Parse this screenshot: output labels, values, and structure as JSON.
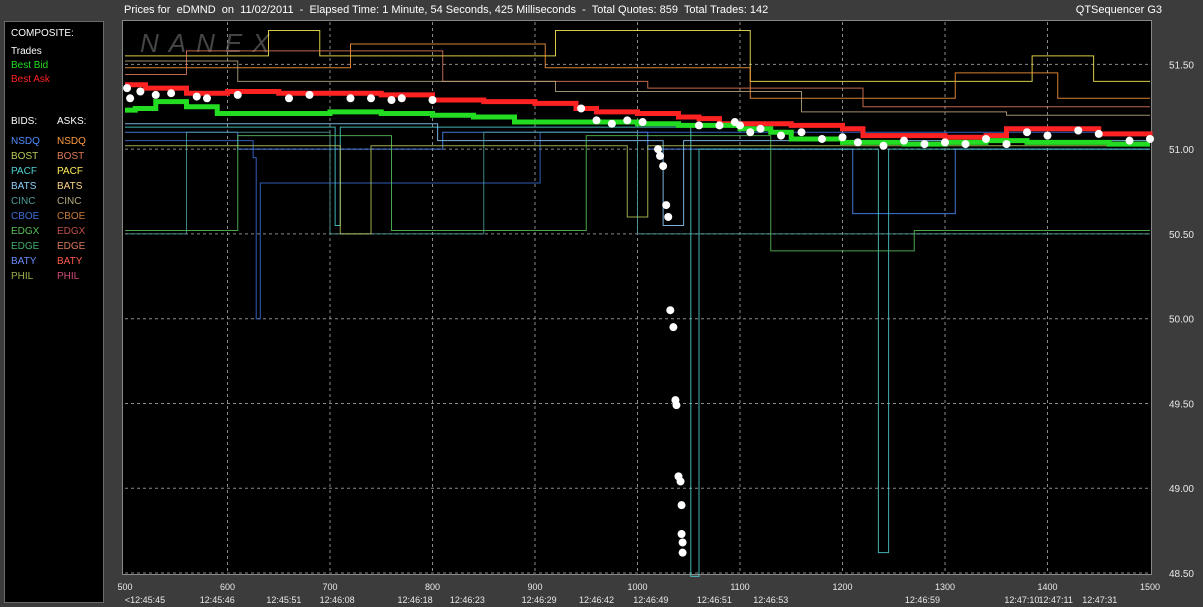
{
  "header": {
    "title": "Prices for  eDMND  on  11/02/2011  -  Elapsed Time: 1 Minute, 54 Seconds, 425 Milliseconds  -  Total Quotes: 859  Total Trades: 142",
    "app": "QTSequencer G3"
  },
  "watermark": "NANEX",
  "legend": {
    "composite_title": "COMPOSITE:",
    "composite": [
      {
        "label": "Trades",
        "color": "#ffffff"
      },
      {
        "label": "Best Bid",
        "color": "#22dd22"
      },
      {
        "label": "Best Ask",
        "color": "#ff2222"
      }
    ],
    "bids_title": "BIDS:",
    "asks_title": "ASKS:",
    "exchanges": [
      {
        "bid": "NSDQ",
        "ask": "NSDQ",
        "bid_color": "#4f8cff",
        "ask_color": "#ff9a3c"
      },
      {
        "bid": "BOST",
        "ask": "BOST",
        "bid_color": "#b7c95a",
        "ask_color": "#e07a5a"
      },
      {
        "bid": "PACF",
        "ask": "PACF",
        "bid_color": "#4fd2d2",
        "ask_color": "#ffee55"
      },
      {
        "bid": "BATS",
        "ask": "BATS",
        "bid_color": "#8fd0ff",
        "ask_color": "#ffd68a"
      },
      {
        "bid": "CINC",
        "ask": "CINC",
        "bid_color": "#4f9a9a",
        "ask_color": "#b8a980"
      },
      {
        "bid": "CBOE",
        "ask": "CBOE",
        "bid_color": "#3a6fd8",
        "ask_color": "#c77a3a"
      },
      {
        "bid": "EDGX",
        "ask": "EDGX",
        "bid_color": "#58c058",
        "ask_color": "#c0504a"
      },
      {
        "bid": "EDGE",
        "ask": "EDGE",
        "bid_color": "#3fae6a",
        "ask_color": "#d8785a"
      },
      {
        "bid": "BATY",
        "ask": "BATY",
        "bid_color": "#6a8cff",
        "ask_color": "#ff5a4a"
      },
      {
        "bid": "PHIL",
        "ask": "PHIL",
        "bid_color": "#9ab04a",
        "ask_color": "#d04a78"
      }
    ]
  },
  "chart_data": {
    "type": "line",
    "xlim": [
      500,
      1500
    ],
    "ylim": [
      48.5,
      51.75
    ],
    "yticks": [
      48.5,
      49.0,
      49.5,
      50.0,
      50.5,
      51.0,
      51.5
    ],
    "ytick_labels": [
      "48.50",
      "49.00",
      "49.50",
      "50.00",
      "50.50",
      "51.00",
      "51.50"
    ],
    "xticks": [
      500,
      600,
      700,
      800,
      900,
      1000,
      1100,
      1200,
      1300,
      1400,
      1500
    ],
    "xtick_labels": [
      "500",
      "600",
      "700",
      "800",
      "900",
      "1000",
      "1100",
      "1200",
      "1300",
      "1400",
      "1500"
    ],
    "time_labels": [
      {
        "x": 500,
        "label": "<12:45:45"
      },
      {
        "x": 590,
        "label": "12:45:46"
      },
      {
        "x": 655,
        "label": "12:45:51"
      },
      {
        "x": 707,
        "label": "12:46:08"
      },
      {
        "x": 783,
        "label": "12:46:18"
      },
      {
        "x": 834,
        "label": "12:46:23"
      },
      {
        "x": 904,
        "label": "12:46:29"
      },
      {
        "x": 960,
        "label": "12:46:42"
      },
      {
        "x": 1013,
        "label": "12:46:49"
      },
      {
        "x": 1075,
        "label": "12:46:51"
      },
      {
        "x": 1130,
        "label": "12:46:53"
      },
      {
        "x": 1278,
        "label": "12:46:59"
      },
      {
        "x": 1375,
        "label": "12:47:10"
      },
      {
        "x": 1408,
        "label": "12:47:11"
      },
      {
        "x": 1451,
        "label": "12:47:31"
      }
    ],
    "series": [
      {
        "name": "Best Ask",
        "color": "#ff2222",
        "points": [
          [
            500,
            51.38
          ],
          [
            520,
            51.36
          ],
          [
            560,
            51.33
          ],
          [
            600,
            51.34
          ],
          [
            650,
            51.33
          ],
          [
            700,
            51.33
          ],
          [
            750,
            51.32
          ],
          [
            800,
            51.29
          ],
          [
            850,
            51.28
          ],
          [
            900,
            51.27
          ],
          [
            940,
            51.24
          ],
          [
            960,
            51.22
          ],
          [
            1000,
            51.21
          ],
          [
            1040,
            51.19
          ],
          [
            1060,
            51.18
          ],
          [
            1080,
            51.15
          ],
          [
            1100,
            51.15
          ],
          [
            1150,
            51.14
          ],
          [
            1200,
            51.12
          ],
          [
            1210,
            51.12
          ],
          [
            1220,
            51.08
          ],
          [
            1260,
            51.08
          ],
          [
            1300,
            51.07
          ],
          [
            1340,
            51.08
          ],
          [
            1360,
            51.12
          ],
          [
            1400,
            51.12
          ],
          [
            1450,
            51.09
          ],
          [
            1500,
            51.07
          ]
        ]
      },
      {
        "name": "Best Bid",
        "color": "#22dd22",
        "points": [
          [
            500,
            51.23
          ],
          [
            510,
            51.24
          ],
          [
            530,
            51.28
          ],
          [
            560,
            51.25
          ],
          [
            590,
            51.21
          ],
          [
            650,
            51.21
          ],
          [
            700,
            51.22
          ],
          [
            750,
            51.21
          ],
          [
            800,
            51.2
          ],
          [
            840,
            51.19
          ],
          [
            880,
            51.16
          ],
          [
            920,
            51.16
          ],
          [
            960,
            51.16
          ],
          [
            1000,
            51.15
          ],
          [
            1040,
            51.14
          ],
          [
            1060,
            51.14
          ],
          [
            1100,
            51.12
          ],
          [
            1130,
            51.1
          ],
          [
            1150,
            51.06
          ],
          [
            1200,
            51.04
          ],
          [
            1260,
            51.03
          ],
          [
            1300,
            51.04
          ],
          [
            1340,
            51.05
          ],
          [
            1380,
            51.04
          ],
          [
            1420,
            51.04
          ],
          [
            1460,
            51.03
          ],
          [
            1500,
            51.03
          ]
        ]
      },
      {
        "name": "Trades",
        "color": "#ffffff",
        "points": [
          [
            502,
            51.36
          ],
          [
            505,
            51.3
          ],
          [
            515,
            51.34
          ],
          [
            530,
            51.32
          ],
          [
            545,
            51.33
          ],
          [
            570,
            51.31
          ],
          [
            580,
            51.3
          ],
          [
            610,
            51.32
          ],
          [
            660,
            51.3
          ],
          [
            680,
            51.32
          ],
          [
            720,
            51.3
          ],
          [
            740,
            51.3
          ],
          [
            760,
            51.29
          ],
          [
            770,
            51.3
          ],
          [
            800,
            51.29
          ],
          [
            945,
            51.24
          ],
          [
            960,
            51.17
          ],
          [
            975,
            51.15
          ],
          [
            990,
            51.17
          ],
          [
            1005,
            51.16
          ],
          [
            1020,
            51.0
          ],
          [
            1022,
            50.96
          ],
          [
            1025,
            50.9
          ],
          [
            1028,
            50.67
          ],
          [
            1030,
            50.6
          ],
          [
            1032,
            50.05
          ],
          [
            1035,
            49.95
          ],
          [
            1037,
            49.52
          ],
          [
            1038,
            49.49
          ],
          [
            1040,
            49.07
          ],
          [
            1042,
            49.04
          ],
          [
            1043,
            48.9
          ],
          [
            1043,
            48.73
          ],
          [
            1044,
            48.68
          ],
          [
            1044,
            48.62
          ],
          [
            1060,
            51.14
          ],
          [
            1080,
            51.14
          ],
          [
            1095,
            51.16
          ],
          [
            1100,
            51.14
          ],
          [
            1110,
            51.1
          ],
          [
            1120,
            51.12
          ],
          [
            1140,
            51.08
          ],
          [
            1160,
            51.1
          ],
          [
            1180,
            51.06
          ],
          [
            1200,
            51.07
          ],
          [
            1215,
            51.04
          ],
          [
            1240,
            51.02
          ],
          [
            1260,
            51.05
          ],
          [
            1280,
            51.03
          ],
          [
            1300,
            51.04
          ],
          [
            1320,
            51.03
          ],
          [
            1340,
            51.06
          ],
          [
            1360,
            51.03
          ],
          [
            1380,
            51.1
          ],
          [
            1400,
            51.08
          ],
          [
            1430,
            51.11
          ],
          [
            1450,
            51.09
          ],
          [
            1480,
            51.05
          ],
          [
            1500,
            51.06
          ]
        ]
      }
    ],
    "exchange_quotes": [
      {
        "color": "#ffee55",
        "points": [
          [
            500,
            51.55
          ],
          [
            620,
            51.55
          ],
          [
            640,
            51.7
          ],
          [
            680,
            51.7
          ],
          [
            690,
            51.55
          ],
          [
            900,
            51.55
          ],
          [
            920,
            51.7
          ],
          [
            1100,
            51.7
          ],
          [
            1110,
            51.4
          ],
          [
            1380,
            51.4
          ],
          [
            1385,
            51.55
          ],
          [
            1440,
            51.55
          ],
          [
            1445,
            51.4
          ],
          [
            1500,
            51.4
          ]
        ]
      },
      {
        "color": "#ff9a3c",
        "points": [
          [
            500,
            51.48
          ],
          [
            700,
            51.48
          ],
          [
            720,
            51.62
          ],
          [
            900,
            51.62
          ],
          [
            910,
            51.48
          ],
          [
            1100,
            51.48
          ],
          [
            1110,
            51.3
          ],
          [
            1300,
            51.3
          ],
          [
            1310,
            51.45
          ],
          [
            1400,
            51.45
          ],
          [
            1410,
            51.3
          ],
          [
            1500,
            51.3
          ]
        ]
      },
      {
        "color": "#e07a5a",
        "points": [
          [
            500,
            51.44
          ],
          [
            540,
            51.44
          ],
          [
            560,
            51.58
          ],
          [
            800,
            51.58
          ],
          [
            810,
            51.4
          ],
          [
            1000,
            51.4
          ],
          [
            1010,
            51.36
          ],
          [
            1200,
            51.36
          ],
          [
            1220,
            51.25
          ],
          [
            1500,
            51.25
          ]
        ]
      },
      {
        "color": "#b8a980",
        "points": [
          [
            500,
            51.52
          ],
          [
            600,
            51.52
          ],
          [
            610,
            51.4
          ],
          [
            900,
            51.4
          ],
          [
            920,
            51.34
          ],
          [
            1150,
            51.34
          ],
          [
            1160,
            51.22
          ],
          [
            1350,
            51.22
          ],
          [
            1360,
            51.2
          ],
          [
            1500,
            51.2
          ]
        ]
      },
      {
        "color": "#4f8cff",
        "points": [
          [
            500,
            51.1
          ],
          [
            600,
            51.1
          ],
          [
            610,
            51.0
          ],
          [
            800,
            51.0
          ],
          [
            810,
            51.1
          ],
          [
            1000,
            51.1
          ],
          [
            1010,
            51.0
          ],
          [
            1200,
            51.0
          ],
          [
            1210,
            50.62
          ],
          [
            1300,
            50.62
          ],
          [
            1310,
            51.0
          ],
          [
            1500,
            51.0
          ]
        ]
      },
      {
        "color": "#3a6fd8",
        "points": [
          [
            500,
            51.05
          ],
          [
            620,
            51.05
          ],
          [
            625,
            50.95
          ],
          [
            628,
            50.95
          ],
          [
            628,
            50.0
          ],
          [
            632,
            50.0
          ],
          [
            632,
            50.8
          ],
          [
            900,
            50.8
          ],
          [
            905,
            51.1
          ],
          [
            1500,
            51.1
          ]
        ]
      },
      {
        "color": "#4fd2d2",
        "points": [
          [
            500,
            51.13
          ],
          [
            700,
            51.13
          ],
          [
            705,
            50.55
          ],
          [
            710,
            50.55
          ],
          [
            710,
            51.13
          ],
          [
            1050,
            51.13
          ],
          [
            1052,
            48.48
          ],
          [
            1060,
            48.48
          ],
          [
            1060,
            51.0
          ],
          [
            1230,
            51.0
          ],
          [
            1235,
            48.62
          ],
          [
            1245,
            48.62
          ],
          [
            1245,
            51.0
          ],
          [
            1500,
            51.0
          ]
        ]
      },
      {
        "color": "#8fd0ff",
        "points": [
          [
            500,
            51.15
          ],
          [
            800,
            51.15
          ],
          [
            805,
            51.05
          ],
          [
            1020,
            51.05
          ],
          [
            1025,
            50.55
          ],
          [
            1040,
            50.55
          ],
          [
            1045,
            51.05
          ],
          [
            1500,
            51.05
          ]
        ]
      },
      {
        "color": "#4f9a9a",
        "points": [
          [
            500,
            50.5
          ],
          [
            560,
            50.5
          ],
          [
            560,
            51.1
          ],
          [
            700,
            51.1
          ],
          [
            700,
            50.5
          ],
          [
            850,
            50.5
          ],
          [
            850,
            51.1
          ],
          [
            1000,
            51.1
          ],
          [
            1000,
            50.5
          ],
          [
            1500,
            50.5
          ]
        ]
      },
      {
        "color": "#58c058",
        "points": [
          [
            500,
            50.52
          ],
          [
            600,
            50.52
          ],
          [
            610,
            51.08
          ],
          [
            750,
            51.08
          ],
          [
            760,
            50.52
          ],
          [
            940,
            50.52
          ],
          [
            950,
            51.08
          ],
          [
            1120,
            51.08
          ],
          [
            1130,
            50.4
          ],
          [
            1260,
            50.4
          ],
          [
            1270,
            50.52
          ],
          [
            1500,
            50.52
          ]
        ]
      },
      {
        "color": "#b7c95a",
        "points": [
          [
            500,
            51.02
          ],
          [
            700,
            51.02
          ],
          [
            710,
            50.5
          ],
          [
            740,
            50.5
          ],
          [
            740,
            51.02
          ],
          [
            980,
            51.02
          ],
          [
            990,
            50.6
          ],
          [
            1010,
            50.6
          ],
          [
            1010,
            51.02
          ],
          [
            1500,
            51.02
          ]
        ]
      }
    ]
  }
}
